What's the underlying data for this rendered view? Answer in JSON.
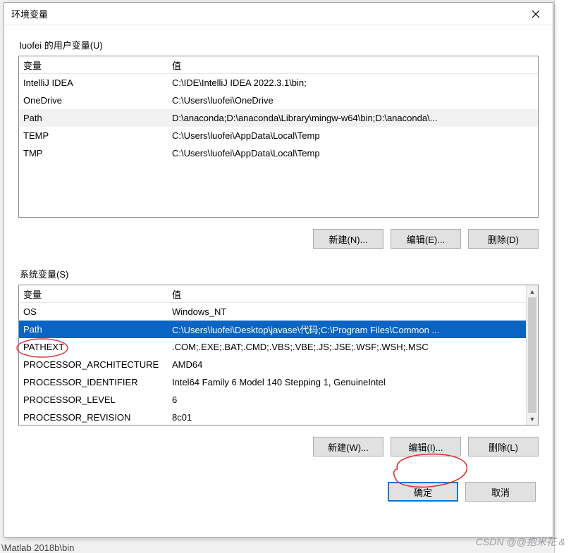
{
  "dialog": {
    "title": "环境变量"
  },
  "user_section": {
    "label": "luofei 的用户变量(U)",
    "header": {
      "col1": "变量",
      "col2": "值"
    },
    "rows": [
      {
        "name": "IntelliJ IDEA",
        "value": "C:\\IDE\\IntelliJ IDEA 2022.3.1\\bin;",
        "selected": false
      },
      {
        "name": "OneDrive",
        "value": "C:\\Users\\luofei\\OneDrive",
        "selected": false
      },
      {
        "name": "Path",
        "value": "D:\\anaconda;D:\\anaconda\\Library\\mingw-w64\\bin;D:\\anaconda\\...",
        "selected": true
      },
      {
        "name": "TEMP",
        "value": "C:\\Users\\luofei\\AppData\\Local\\Temp",
        "selected": false
      },
      {
        "name": "TMP",
        "value": "C:\\Users\\luofei\\AppData\\Local\\Temp",
        "selected": false
      }
    ],
    "buttons": {
      "new": "新建(N)...",
      "edit": "编辑(E)...",
      "delete": "删除(D)"
    }
  },
  "system_section": {
    "label": "系统变量(S)",
    "header": {
      "col1": "变量",
      "col2": "值"
    },
    "rows": [
      {
        "name": "OS",
        "value": "Windows_NT",
        "selected": false
      },
      {
        "name": "Path",
        "value": "C:\\Users\\luofei\\Desktop\\javase\\代码;C:\\Program Files\\Common ...",
        "selected": true
      },
      {
        "name": "PATHEXT",
        "value": ".COM;.EXE;.BAT;.CMD;.VBS;.VBE;.JS;.JSE;.WSF;.WSH;.MSC",
        "selected": false
      },
      {
        "name": "PROCESSOR_ARCHITECTURE",
        "value": "AMD64",
        "selected": false
      },
      {
        "name": "PROCESSOR_IDENTIFIER",
        "value": "Intel64 Family 6 Model 140 Stepping 1, GenuineIntel",
        "selected": false
      },
      {
        "name": "PROCESSOR_LEVEL",
        "value": "6",
        "selected": false
      },
      {
        "name": "PROCESSOR_REVISION",
        "value": "8c01",
        "selected": false
      }
    ],
    "buttons": {
      "new": "新建(W)...",
      "edit": "编辑(I)...",
      "delete": "删除(L)"
    }
  },
  "footer": {
    "ok": "确定",
    "cancel": "取消"
  },
  "background": {
    "partial_path": "\\Matlab 2018b\\bin"
  },
  "watermark": "CSDN @@抱米花 &"
}
